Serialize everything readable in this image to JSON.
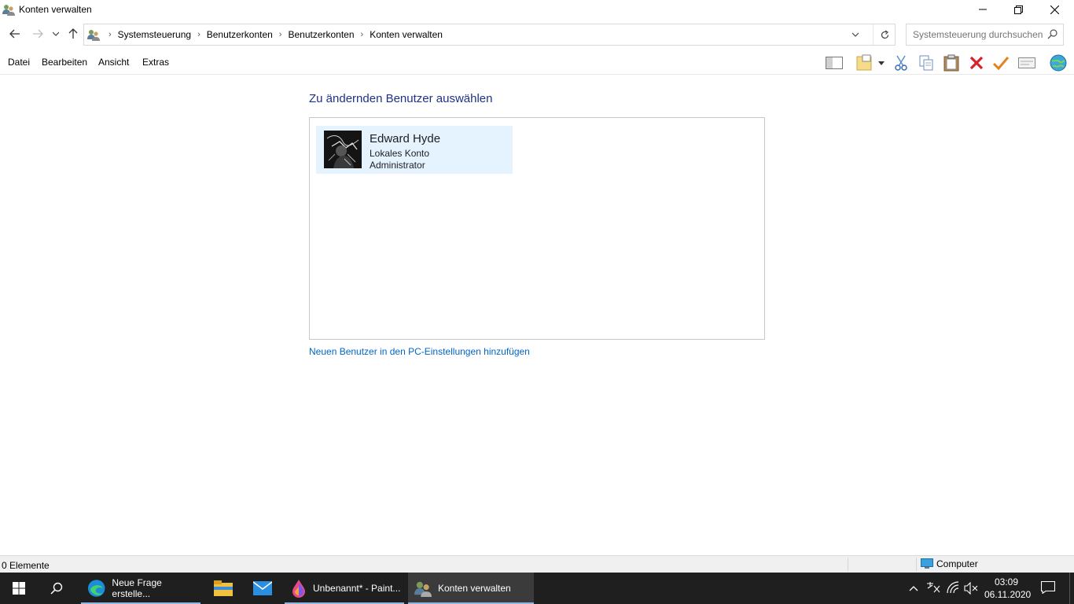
{
  "window": {
    "title": "Konten verwalten"
  },
  "address": {
    "breadcrumbs": [
      "Systemsteuerung",
      "Benutzerkonten",
      "Benutzerkonten",
      "Konten verwalten"
    ],
    "search_placeholder": "Systemsteuerung durchsuchen"
  },
  "menu": {
    "items": [
      "Datei",
      "Bearbeiten",
      "Ansicht",
      "Extras"
    ]
  },
  "toolbar": {
    "icons": [
      "preview-pane-icon",
      "new-folder-icon",
      "dropdown-icon",
      "cut-icon",
      "copy-icon",
      "paste-icon",
      "delete-icon",
      "check-icon",
      "properties-icon",
      "globe-icon"
    ]
  },
  "main": {
    "heading": "Zu ändernden Benutzer auswählen",
    "users": [
      {
        "name": "Edward Hyde",
        "type": "Lokales Konto",
        "role": "Administrator"
      }
    ],
    "add_user_link": "Neuen Benutzer in den PC-Einstellungen hinzufügen"
  },
  "status": {
    "count": "0 Elemente",
    "location": "Computer"
  },
  "taskbar": {
    "apps": [
      {
        "label": "Neue Frage erstelle...",
        "icon": "edge-icon"
      },
      {
        "label": "",
        "icon": "file-explorer-icon"
      },
      {
        "label": "",
        "icon": "mail-icon"
      },
      {
        "label": "Unbenannt* - Paint...",
        "icon": "paint3d-icon"
      },
      {
        "label": "Konten verwalten",
        "icon": "user-accounts-icon"
      }
    ],
    "clock": {
      "time": "03:09",
      "date": "06.11.2020"
    }
  },
  "colors": {
    "accent_link": "#0066cc",
    "heading": "#1e3287",
    "selection": "#e5f3ff",
    "taskbar": "#1f1f1f"
  }
}
